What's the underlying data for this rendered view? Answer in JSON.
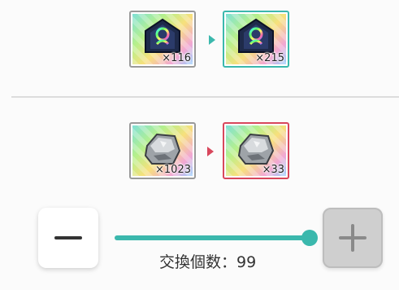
{
  "exchanges": [
    {
      "source": {
        "icon": "rainbow-crest-icon",
        "count": "×116"
      },
      "target": {
        "icon": "rainbow-crest-icon",
        "count": "×215"
      },
      "arrow_color": "#3bb8ad"
    },
    {
      "source": {
        "icon": "silver-ore-icon",
        "count": "×1023"
      },
      "target": {
        "icon": "silver-ore-icon",
        "count": "×33"
      },
      "arrow_color": "#d8475c"
    }
  ],
  "quantity": {
    "label": "交換個数：99",
    "value": 99,
    "slider_fraction": 1.0
  },
  "colors": {
    "accent": "#3bb8ad",
    "warning": "#d8475c"
  }
}
